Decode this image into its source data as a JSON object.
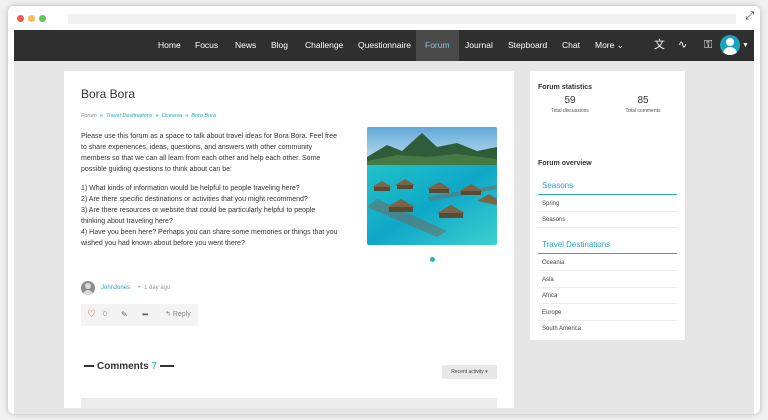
{
  "nav": {
    "items": [
      "Home",
      "Focus",
      "News",
      "Blog",
      "Challenge",
      "Questionnaire",
      "Forum",
      "Journal",
      "Stepboard",
      "Chat"
    ],
    "more_label": "More",
    "active": "Forum",
    "icons": [
      "translate-icon",
      "wave-icon",
      "key-icon",
      "user-avatar-icon"
    ]
  },
  "forum": {
    "title": "Bora Bora",
    "breadcrumb": [
      "Forum",
      "Travel Destinations",
      "Oceania",
      "Bora Bora"
    ],
    "intro": "Please use this forum as a space to talk about travel ideas for Bora Bora. Feel free to share experiences, ideas, questions, and answers with other community members so that we can all learn from each other and help each other. Some possible guiding questions to think about can be:",
    "questions": [
      "1) What kinds of information would be helpful to people traveling here?",
      "2) Are there specific destinations or activities that you might recommend?",
      "3) Are there resources or website that could be particularly helpful to people thinking about traveling here?",
      "4) Have you been here? Perhaps you can share some memories or things that you wished you had known about before you went there?"
    ],
    "author": "JohnJones",
    "time_ago": "1 day ago",
    "likes": "0",
    "reply_label": "Reply",
    "comments_label": "Comments",
    "comments_count": "7",
    "sort_label": "Recent activity ▾"
  },
  "sidebar": {
    "stats_heading": "Forum statistics",
    "total_discussions": "59",
    "total_discussions_label": "Total discussions",
    "total_comments": "85",
    "total_comments_label": "Total comments",
    "overview_heading": "Forum overview",
    "seasons_heading": "Seasons",
    "seasons": [
      "Spring",
      "Seasons"
    ],
    "destinations_heading": "Travel Destinations",
    "destinations": [
      "Oceania",
      "Asia",
      "Africa",
      "Europe",
      "South America"
    ]
  },
  "colors": {
    "accent": "#26a8c0",
    "nav_bg": "#2f2f2f",
    "heart": "#dd3333"
  }
}
